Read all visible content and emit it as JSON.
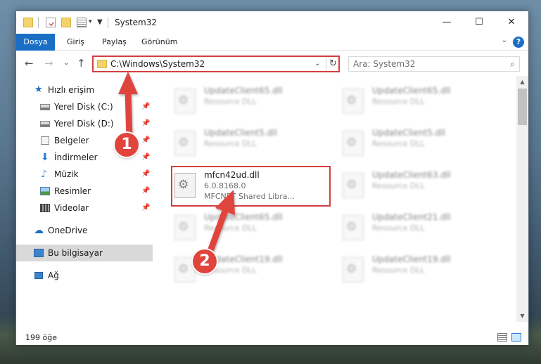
{
  "window": {
    "title": "System32",
    "minimize": "—",
    "maximize": "☐",
    "close": "✕"
  },
  "ribbon": {
    "tabs": [
      {
        "label": "Dosya"
      },
      {
        "label": "Giriş"
      },
      {
        "label": "Paylaş"
      },
      {
        "label": "Görünüm"
      }
    ],
    "help": "?"
  },
  "address": {
    "path": "C:\\Windows\\System32"
  },
  "search": {
    "placeholder": "Ara: System32"
  },
  "nav": {
    "items": [
      {
        "label": "Hızlı erişim"
      },
      {
        "label": "Yerel Disk (C:)"
      },
      {
        "label": "Yerel Disk (D:)"
      },
      {
        "label": "Belgeler"
      },
      {
        "label": "İndirmeler"
      },
      {
        "label": "Müzik"
      },
      {
        "label": "Resimler"
      },
      {
        "label": "Videolar"
      },
      {
        "label": "OneDrive"
      },
      {
        "label": "Bu bilgisayar"
      },
      {
        "label": "Ağ"
      }
    ]
  },
  "files": [
    {
      "name": "UpdateClient65.dll",
      "line1": "Resource DLL",
      "line2": ""
    },
    {
      "name": "UpdateClient65.dll",
      "line1": "Resource DLL",
      "line2": ""
    },
    {
      "name": "UpdateClient5.dll",
      "line1": "Resource DLL",
      "line2": ""
    },
    {
      "name": "UpdateClient5.dll",
      "line1": "Resource DLL",
      "line2": ""
    },
    {
      "name": "mfcn42ud.dll",
      "line1": "6.0.8168.0",
      "line2": "MFCNET Shared Libra..."
    },
    {
      "name": "UpdateClient63.dll",
      "line1": "Resource DLL",
      "line2": ""
    },
    {
      "name": "UpdateClient65.dll",
      "line1": "Resource DLL",
      "line2": ""
    },
    {
      "name": "UpdateClient21.dll",
      "line1": "Resource DLL",
      "line2": ""
    },
    {
      "name": "UpdateClient19.dll",
      "line1": "Resource DLL",
      "line2": ""
    },
    {
      "name": "UpdateClient19.dll",
      "line1": "Resource DLL",
      "line2": ""
    }
  ],
  "status": {
    "count": "199 öğe"
  },
  "annotations": {
    "badge1": "1",
    "badge2": "2"
  },
  "colors": {
    "accent": "#1a6fc4",
    "highlight": "#d24040",
    "annotation": "#e0443d",
    "selection": "#cde8fb"
  }
}
